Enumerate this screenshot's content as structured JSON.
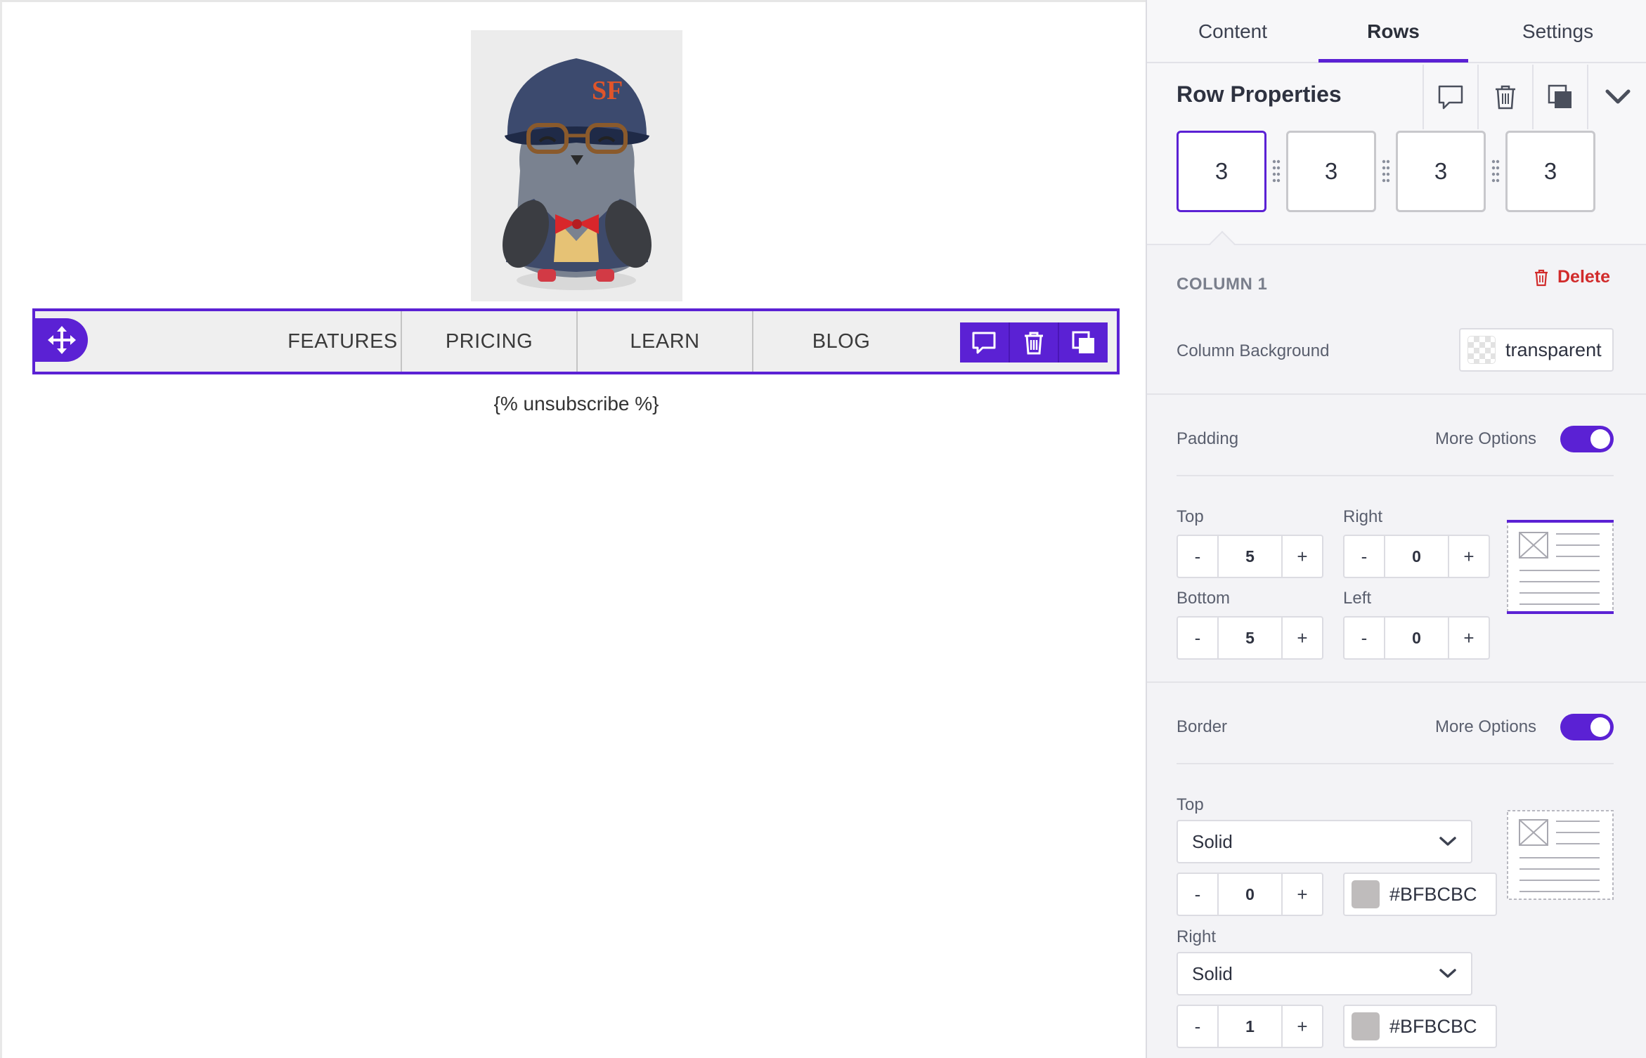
{
  "canvas": {
    "menu": {
      "items": [
        "FEATURES",
        "PRICING",
        "LEARN",
        "BLOG"
      ]
    },
    "unsubscribe_text": "{% unsubscribe %}"
  },
  "sidebar": {
    "tabs": [
      {
        "label": "Content",
        "active": false
      },
      {
        "label": "Rows",
        "active": true
      },
      {
        "label": "Settings",
        "active": false
      }
    ],
    "row_properties": {
      "title": "Row Properties",
      "columns": [
        "3",
        "3",
        "3",
        "3"
      ],
      "selected_column": 1
    },
    "column": {
      "title": "COLUMN 1",
      "delete_label": "Delete",
      "background_label": "Column Background",
      "background_value": "transparent",
      "padding": {
        "label": "Padding",
        "more_options_label": "More Options",
        "more_options_enabled": true,
        "top_label": "Top",
        "top": "5",
        "right_label": "Right",
        "right": "0",
        "bottom_label": "Bottom",
        "bottom": "5",
        "left_label": "Left",
        "left": "0"
      },
      "border": {
        "label": "Border",
        "more_options_label": "More Options",
        "more_options_enabled": true,
        "top_label": "Top",
        "top_style": "Solid",
        "top_width": "0",
        "top_color": "#BFBCBC",
        "right_label": "Right",
        "right_style": "Solid",
        "right_width": "1",
        "right_color": "#BFBCBC"
      }
    },
    "stepper_minus": "-",
    "stepper_plus": "+"
  },
  "colors": {
    "accent": "#5b21d4",
    "delete": "#d12b2b",
    "border_swatch": "#BFBCBC"
  }
}
